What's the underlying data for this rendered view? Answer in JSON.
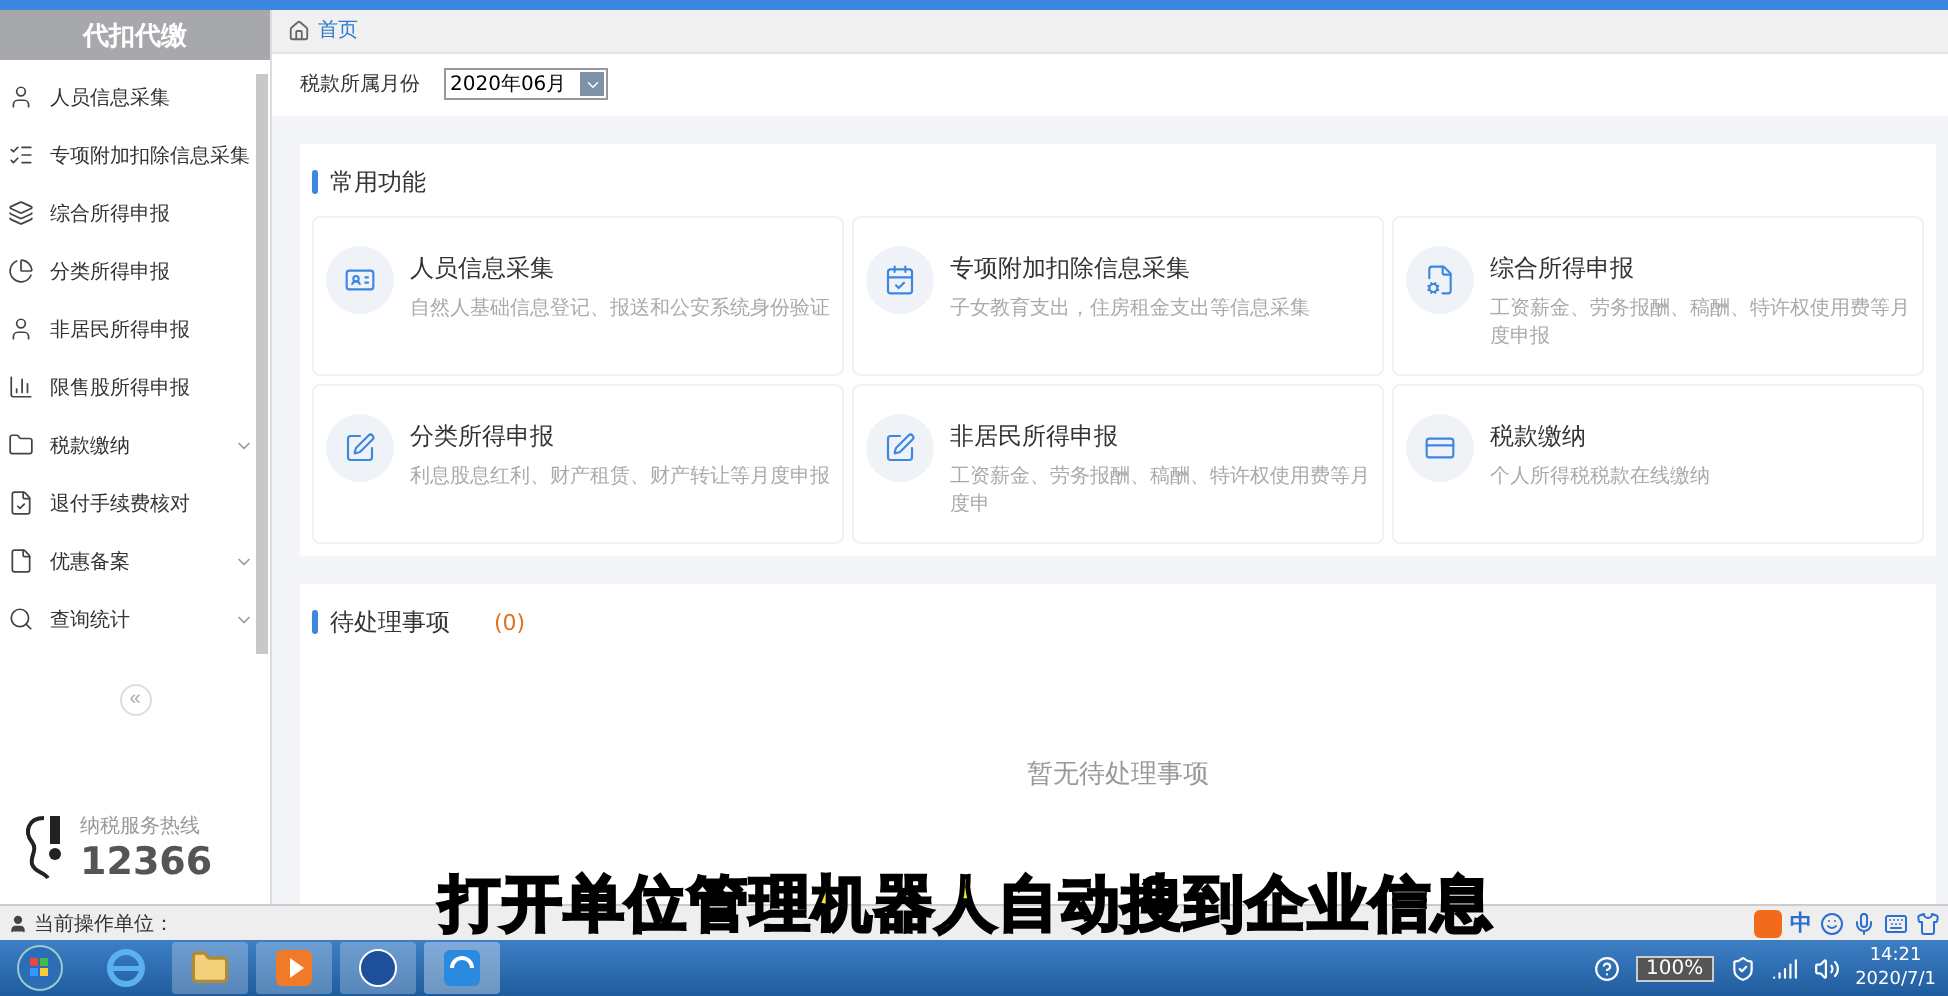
{
  "sidebar": {
    "title": "代扣代缴",
    "items": [
      {
        "label": "人员信息采集",
        "expandable": false
      },
      {
        "label": "专项附加扣除信息采集",
        "expandable": false
      },
      {
        "label": "综合所得申报",
        "expandable": false
      },
      {
        "label": "分类所得申报",
        "expandable": false
      },
      {
        "label": "非居民所得申报",
        "expandable": false
      },
      {
        "label": "限售股所得申报",
        "expandable": false
      },
      {
        "label": "税款缴纳",
        "expandable": true
      },
      {
        "label": "退付手续费核对",
        "expandable": false
      },
      {
        "label": "优惠备案",
        "expandable": true
      },
      {
        "label": "查询统计",
        "expandable": true
      }
    ],
    "collapse": "«",
    "hotline": {
      "label": "纳税服务热线",
      "number": "12366"
    }
  },
  "breadcrumb": {
    "home": "首页"
  },
  "filter": {
    "label": "税款所属月份",
    "value": "2020年06月"
  },
  "functions": {
    "title": "常用功能",
    "cards": [
      {
        "title": "人员信息采集",
        "desc": "自然人基础信息登记、报送和公安系统身份验证"
      },
      {
        "title": "专项附加扣除信息采集",
        "desc": "子女教育支出，住房租金支出等信息采集"
      },
      {
        "title": "综合所得申报",
        "desc": "工资薪金、劳务报酬、稿酬、特许权使用费等月度申报"
      },
      {
        "title": "分类所得申报",
        "desc": "利息股息红利、财产租赁、财产转让等月度申报"
      },
      {
        "title": "非居民所得申报",
        "desc": "工资薪金、劳务报酬、稿酬、特许权使用费等月度申"
      },
      {
        "title": "税款缴纳",
        "desc": "个人所得税税款在线缴纳"
      }
    ]
  },
  "pending": {
    "title": "待处理事项",
    "count": "(0)",
    "empty": "暂无待处理事项"
  },
  "status_bar": {
    "label": "当前操作单位："
  },
  "subtitle": "打开单位管理机器人自动搜到企业信息",
  "ime": {
    "mode": "中"
  },
  "tray": {
    "battery": "100%",
    "time": "14:21",
    "date": "2020/7/1"
  }
}
